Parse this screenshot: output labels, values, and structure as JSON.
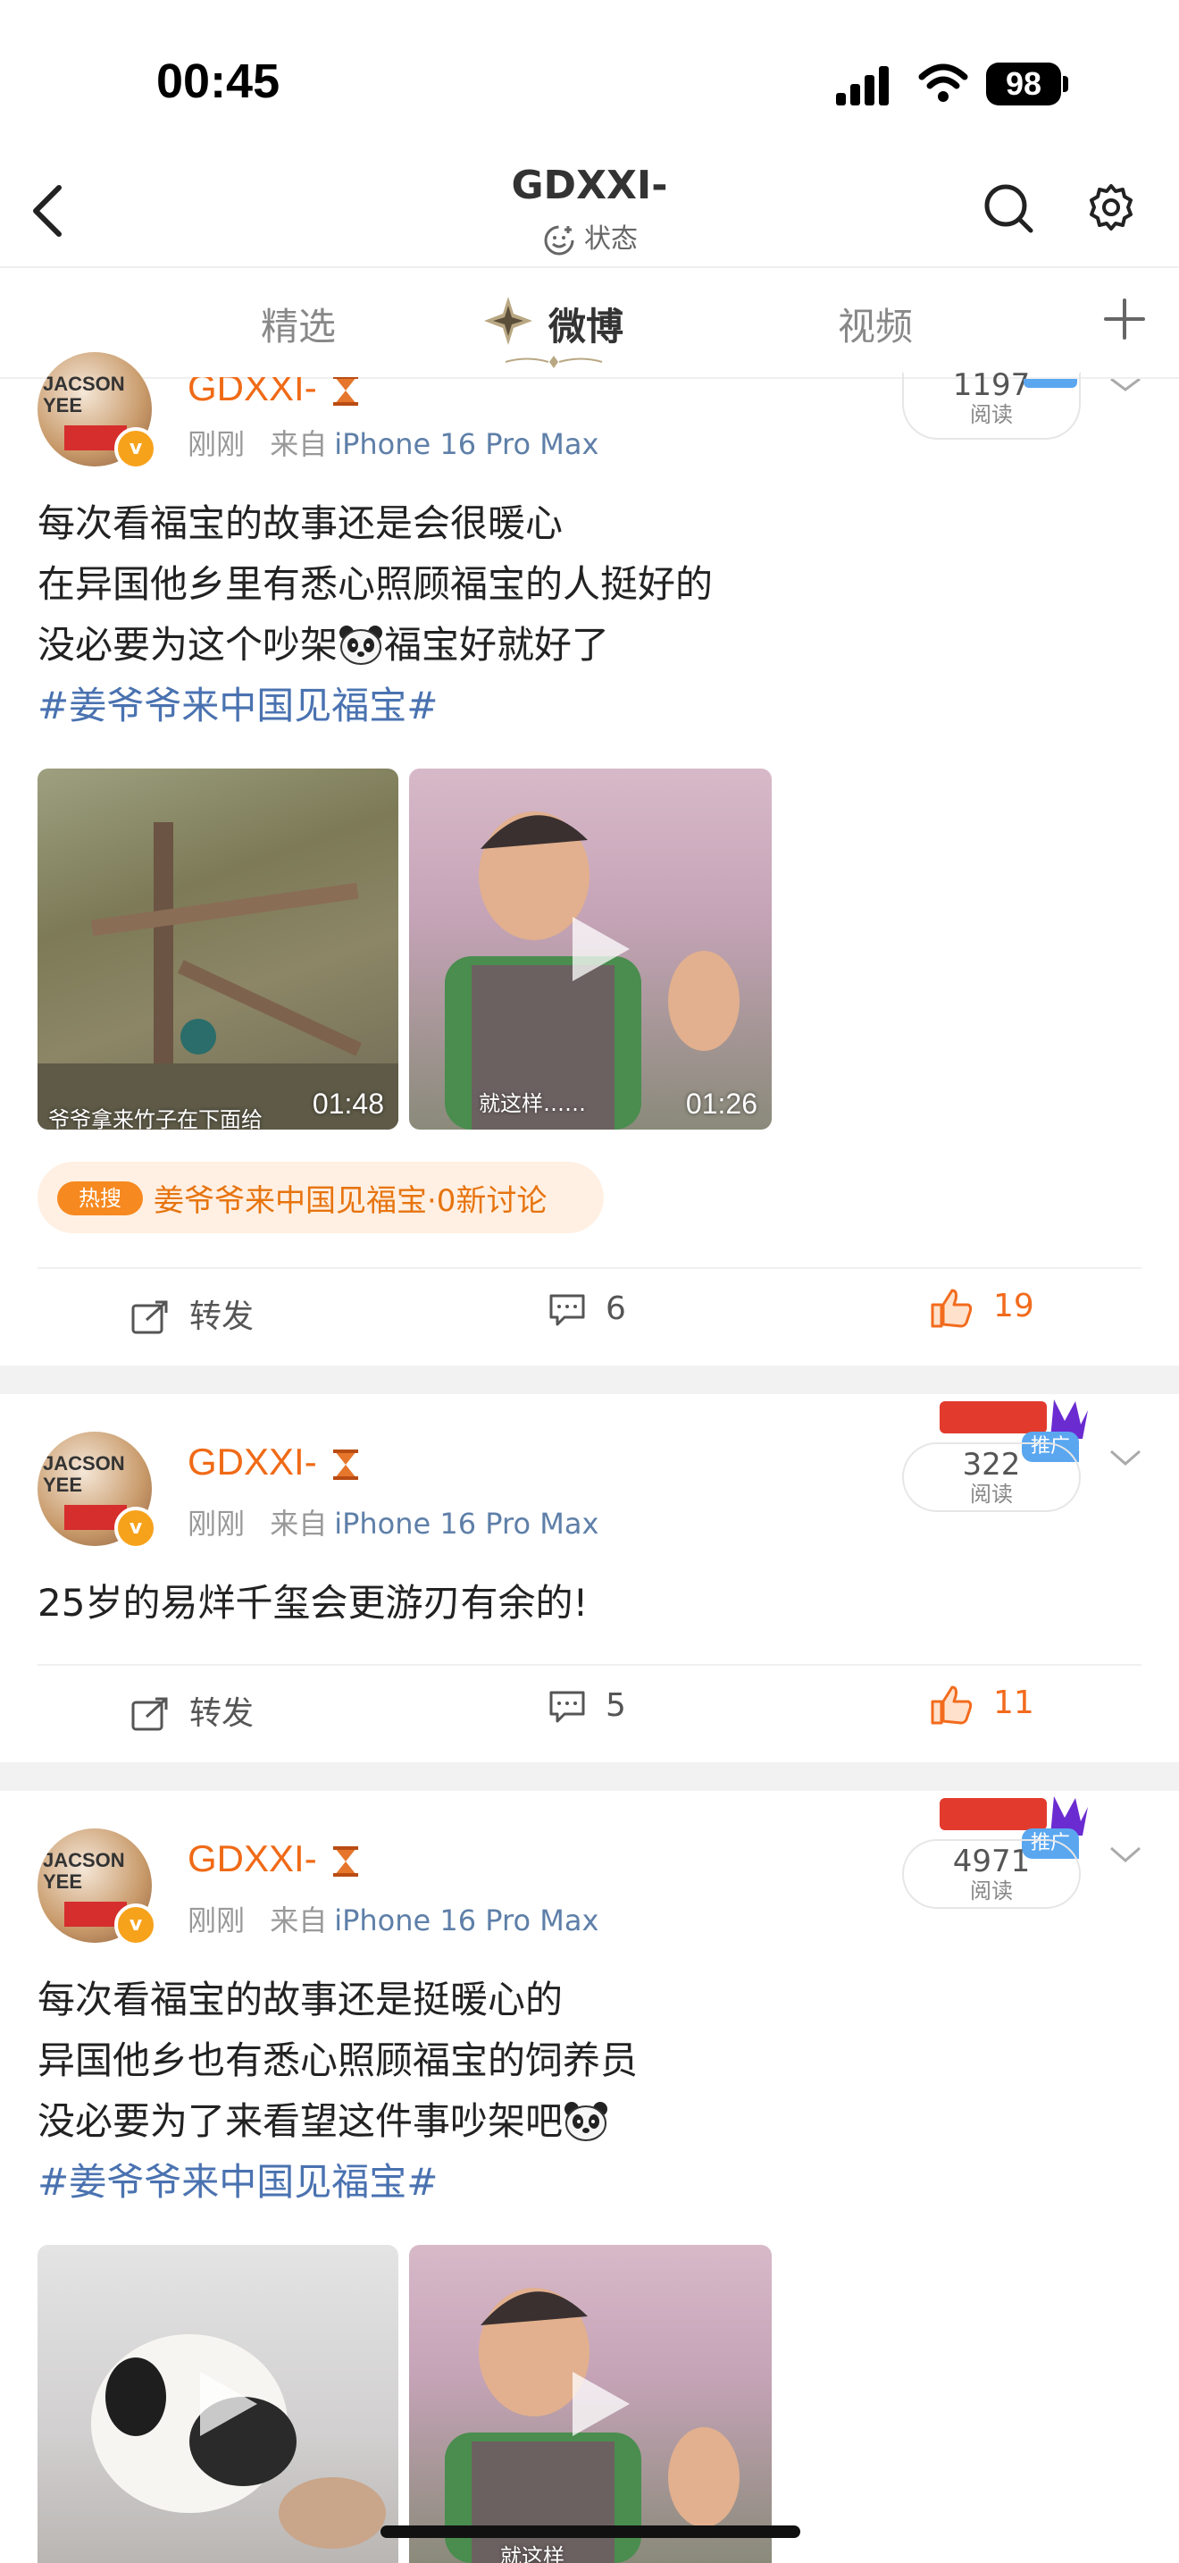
{
  "status_bar": {
    "time": "00:45",
    "battery": "98"
  },
  "header": {
    "title": "GDXXI-",
    "status_label": "状态"
  },
  "tabs": [
    {
      "label": "精选",
      "active": false
    },
    {
      "label": "微博",
      "active": true
    },
    {
      "label": "视频",
      "active": false
    }
  ],
  "posts": [
    {
      "user": "GDXXI-",
      "avatar_text": "JACSON YEE",
      "time": "刚刚",
      "source_prefix": "来自",
      "source": "iPhone 16 Pro Max",
      "reads": "1197",
      "reads_label": "阅读",
      "lines": [
        "每次看福宝的故事还是会很暖心",
        "在异国他乡里有悉心照顾福宝的人挺好的",
        "没必要为这个吵架",
        "福宝好就好了"
      ],
      "topic": "#姜爷爷来中国见福宝#",
      "videos": [
        {
          "duration": "01:48",
          "caption": "爷爷拿来竹子在下面给"
        },
        {
          "duration": "01:26",
          "caption": "就这样……"
        }
      ],
      "hot": {
        "badge": "热搜",
        "text": "姜爷爷来中国见福宝·0新讨论"
      },
      "actions": {
        "repost": "转发",
        "comments": "6",
        "likes": "19"
      }
    },
    {
      "user": "GDXXI-",
      "avatar_text": "JACSON YEE",
      "time": "刚刚",
      "source_prefix": "来自",
      "source": "iPhone 16 Pro Max",
      "reads": "322",
      "reads_label": "阅读",
      "promo": "推广",
      "lines": [
        "25岁的易烊千玺会更游刃有余的!"
      ],
      "actions": {
        "repost": "转发",
        "comments": "5",
        "likes": "11"
      }
    },
    {
      "user": "GDXXI-",
      "avatar_text": "JACSON YEE",
      "time": "刚刚",
      "source_prefix": "来自",
      "source": "iPhone 16 Pro Max",
      "reads": "4971",
      "reads_label": "阅读",
      "promo": "推广",
      "lines": [
        "每次看福宝的故事还是挺暖心的",
        "异国他乡也有悉心照顾福宝的饲养员",
        "没必要为了来看望这件事吵架吧"
      ],
      "topic": "#姜爷爷来中国见福宝#",
      "videos": [
        {
          "duration": "",
          "caption": ""
        },
        {
          "duration": "",
          "caption": "就这样"
        }
      ]
    }
  ],
  "colors": {
    "username": "#f06a16",
    "topic": "#4a72b0",
    "like": "#f26b1d",
    "source": "#5e7fa8"
  }
}
